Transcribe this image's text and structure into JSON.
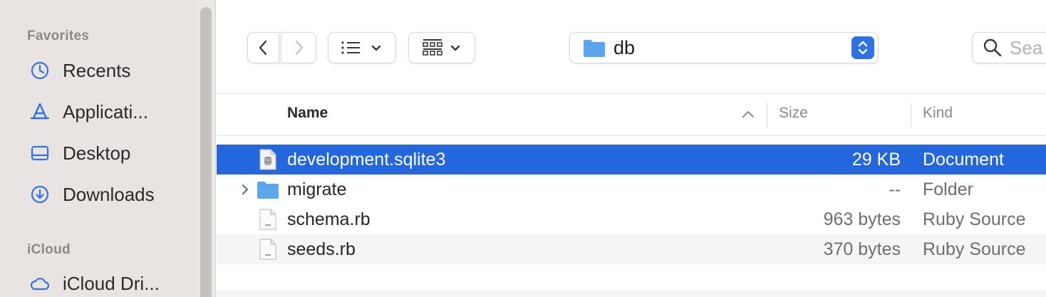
{
  "sidebar": {
    "favorites_title": "Favorites",
    "icloud_title": "iCloud",
    "items": [
      {
        "label": "Recents",
        "icon": "clock-icon"
      },
      {
        "label": "Applicati...",
        "icon": "applications-icon"
      },
      {
        "label": "Desktop",
        "icon": "desktop-icon"
      },
      {
        "label": "Downloads",
        "icon": "downloads-icon"
      }
    ],
    "icloud_items": [
      {
        "label": "iCloud Dri...",
        "icon": "cloud-icon"
      }
    ]
  },
  "toolbar": {
    "back_icon": "chevron-left-icon",
    "forward_icon": "chevron-right-icon",
    "list_view_icon": "list-view-icon",
    "grid_view_icon": "grid-view-icon",
    "path_label": "db",
    "search_placeholder": "Sea"
  },
  "columns": {
    "name": "Name",
    "size": "Size",
    "kind": "Kind"
  },
  "files": [
    {
      "name": "development.sqlite3",
      "size": "29 KB",
      "kind": "Document",
      "icon": "sqlite-document-icon",
      "selected": true
    },
    {
      "name": "migrate",
      "size": "--",
      "kind": "Folder",
      "icon": "folder-icon",
      "selected": false
    },
    {
      "name": "schema.rb",
      "size": "963 bytes",
      "kind": "Ruby Source",
      "icon": "ruby-file-icon",
      "selected": false
    },
    {
      "name": "seeds.rb",
      "size": "370 bytes",
      "kind": "Ruby Source",
      "icon": "ruby-file-icon",
      "selected": false
    }
  ],
  "colors": {
    "selection": "#2366dd",
    "folder": "#5aa7f0",
    "sidebar_icon": "#2f72e6",
    "sidebar_bg": "#e9e4e2"
  }
}
